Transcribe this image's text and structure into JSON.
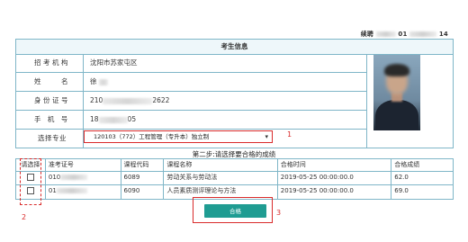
{
  "header": {
    "id_prefix": "续聘",
    "id_value": "01",
    "id_suffix": "14"
  },
  "info": {
    "title": "考生信息",
    "rows": [
      {
        "label": "招考机构",
        "value": "沈阳市苏家屯区"
      },
      {
        "label": "姓　　名",
        "value": "徐"
      },
      {
        "label": "身份证号",
        "value_prefix": "210",
        "value_suffix": "2622"
      },
      {
        "label": "手 机 号",
        "value_prefix": "18",
        "value_suffix": "05"
      },
      {
        "label": "选择专业"
      }
    ],
    "major_select": "120103（772）工程管理（专升本）独立制"
  },
  "step2": {
    "title": "第二步:请选择要合格的成绩",
    "columns": [
      "请选择",
      "准考证号",
      "课程代码",
      "课程名称",
      "合格时间",
      "合格成绩"
    ],
    "rows": [
      {
        "exam_no": "010",
        "code": "6089",
        "name": "劳动关系与劳动法",
        "time": "2019-05-25 00:00:00.0",
        "score": "62.0"
      },
      {
        "exam_no": "01",
        "code": "6090",
        "name": "人员素质测评理论与方法",
        "time": "2019-05-25 00:00:00.0",
        "score": "69.0"
      }
    ]
  },
  "submit_label": "合格",
  "annotations": {
    "m1": "1",
    "m2": "2",
    "m3": "3"
  },
  "colors": {
    "border": "#7fb6c8",
    "accent": "#1f9c92",
    "annotation": "#d92b2b"
  }
}
